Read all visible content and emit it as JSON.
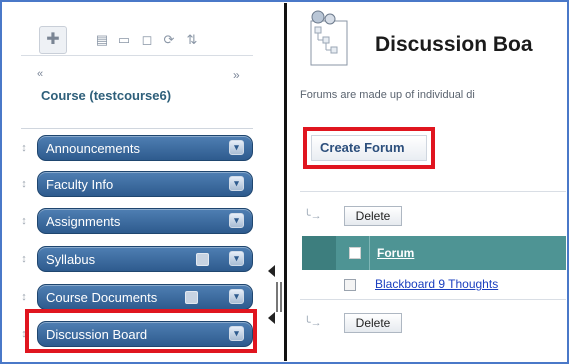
{
  "course_menu": {
    "course_title": "Course (testcourse6)",
    "collapse_up_glyph": "«",
    "collapse_right_glyph": "»",
    "toolbar_icons": [
      "plus-icon",
      "list-view-icon",
      "folder-view-icon",
      "window-icon",
      "refresh-icon",
      "sort-icon"
    ],
    "items": [
      {
        "label": "Announcements",
        "badge": false
      },
      {
        "label": "Faculty Info",
        "badge": false
      },
      {
        "label": "Assignments",
        "badge": false
      },
      {
        "label": "Syllabus",
        "badge": true
      },
      {
        "label": "Course Documents",
        "badge": true
      },
      {
        "label": "Discussion Board",
        "badge": false
      }
    ],
    "highlighted_item": "Discussion Board"
  },
  "content": {
    "page_title": "Discussion Boa",
    "description": "Forums are made up of individual di",
    "create_button": "Create Forum",
    "delete_top": "Delete",
    "delete_bottom": "Delete",
    "table": {
      "column_forum": "Forum",
      "rows": [
        {
          "forum": "Blackboard 9 Thoughts"
        }
      ]
    }
  },
  "colors": {
    "menu_pill": "#2e5b8e",
    "highlight_red": "#e0151f",
    "table_header": "#4e9494",
    "frame_blue": "#4a78c8"
  }
}
